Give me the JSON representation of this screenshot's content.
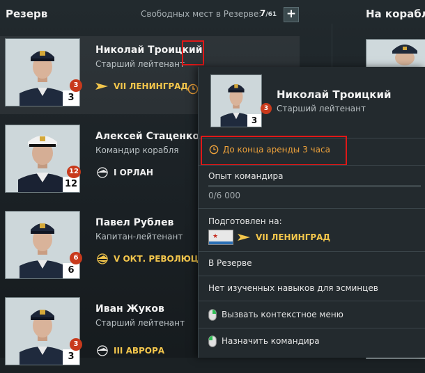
{
  "header": {
    "reserve_title": "Резерв",
    "free_label": "Свободных мест в Резерве:",
    "free_used": "7",
    "free_total": "/61",
    "add_label": "+",
    "ships_title": "На кораблях"
  },
  "commanders": [
    {
      "name": "Николай Троицкий",
      "rank": "Старший лейтенант",
      "level": "3",
      "badge": "3",
      "ship": "VII ЛЕНИНГРАД",
      "ship_color": "gold"
    },
    {
      "name": "Алексей Стаценко",
      "rank": "Командир корабля",
      "level": "12",
      "badge": "12",
      "ship": "I ОРЛАН",
      "ship_color": "white"
    },
    {
      "name": "Павел Рублев",
      "rank": "Капитан-лейтенант",
      "level": "6",
      "badge": "6",
      "ship": "V ОКТ. РЕВОЛЮЦИЯ",
      "ship_color": "gold"
    },
    {
      "name": "Иван Жуков",
      "rank": "Старший лейтенант",
      "level": "3",
      "badge": "3",
      "ship": "III АВРОРА",
      "ship_color": "gold"
    }
  ],
  "tooltip": {
    "name": "Николай Троицкий",
    "rank": "Старший лейтенант",
    "level": "3",
    "badge": "3",
    "rent_text": "До конца аренды 3 часа",
    "exp_label": "Опыт командира",
    "exp_value": "0/6 000",
    "exp_progress": 0,
    "trained_label": "Подготовлен на:",
    "trained_ship": "VII ЛЕНИНГРАД",
    "status": "В Резерве",
    "skills_text": "Нет изученных навыков для эсминцев",
    "action_context": "Вызвать контекстное меню",
    "action_assign": "Назначить командира"
  },
  "colors": {
    "accent_gold": "#f3c64c",
    "rent_orange": "#f0a33b",
    "badge_red": "#c83a1c",
    "highlight_red": "#e01818"
  }
}
